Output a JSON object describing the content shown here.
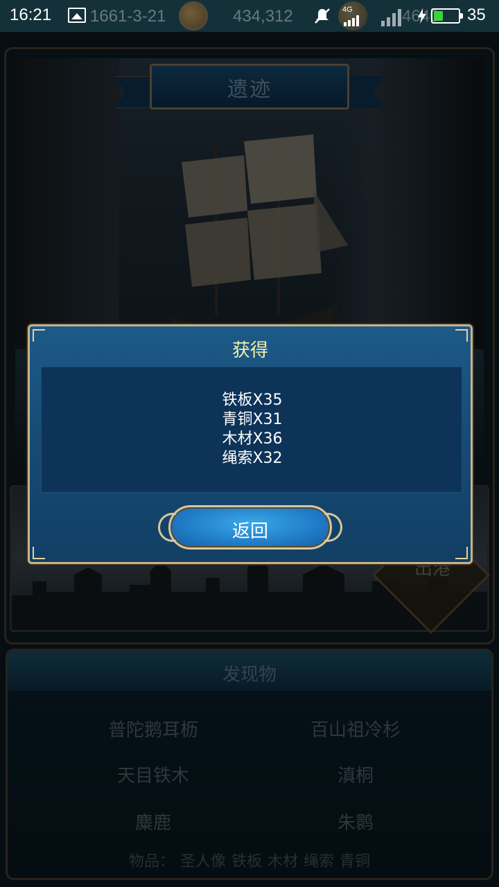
{
  "status_bar": {
    "time": "16:21",
    "date": "1661-3-21",
    "gold": "434,312",
    "network": "4G",
    "battery_level": "35",
    "battery_fraction": 0.35,
    "crew": "4640"
  },
  "page": {
    "title": "遗迹",
    "port_label": "出港"
  },
  "findings": {
    "title": "发现物",
    "items": [
      "普陀鹅耳枥",
      "百山祖冷杉",
      "天目铁木",
      "滇桐",
      "麋鹿",
      "朱鹮"
    ],
    "goods_label": "物品：",
    "goods": [
      "圣人像",
      "铁板",
      "木材",
      "绳索",
      "青铜"
    ]
  },
  "dialog": {
    "title": "获得",
    "rewards": [
      "铁板X35",
      "青铜X31",
      "木材X36",
      "绳索X32"
    ],
    "back_label": "返回"
  },
  "colors": {
    "dialog_title": "#f6f0a8",
    "dialog_bg": "#164a74",
    "dialog_border": "#c9b48a",
    "button": "#1f7bc6",
    "battery": "#3cd23c"
  }
}
